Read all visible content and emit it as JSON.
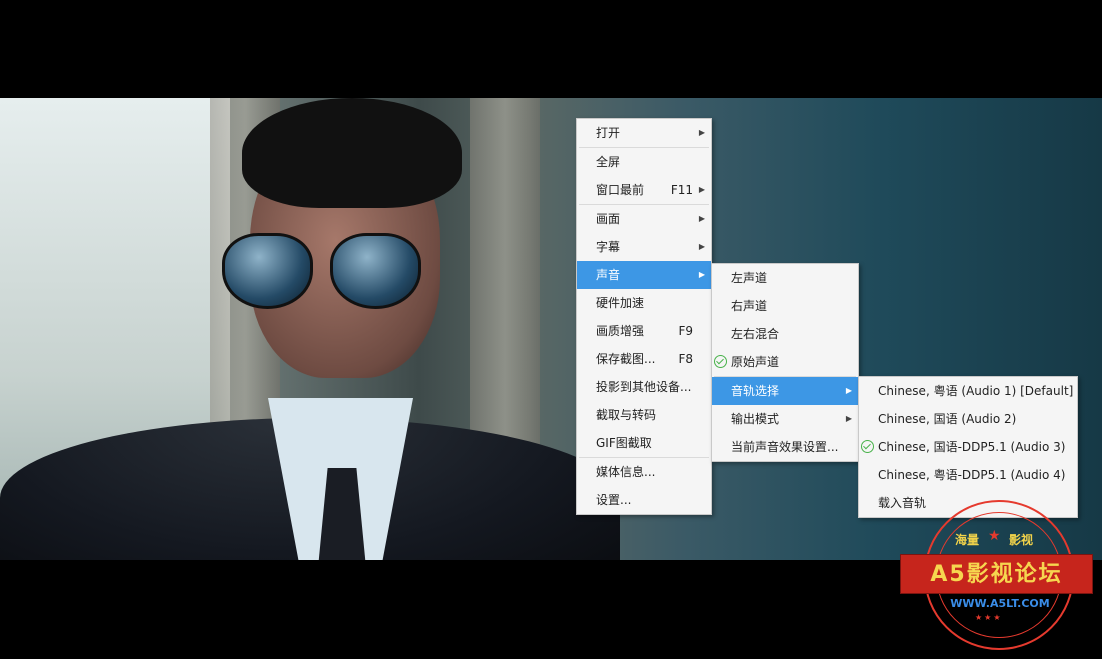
{
  "main_menu": [
    {
      "label": "打开",
      "shortcut": "",
      "submenu": true
    },
    {
      "sep": true
    },
    {
      "label": "全屏",
      "shortcut": "",
      "submenu": false
    },
    {
      "label": "窗口最前",
      "shortcut": "F11",
      "submenu": true
    },
    {
      "sep": true
    },
    {
      "label": "画面",
      "shortcut": "",
      "submenu": true
    },
    {
      "label": "字幕",
      "shortcut": "",
      "submenu": true
    },
    {
      "label": "声音",
      "shortcut": "",
      "submenu": true,
      "highlighted": true
    },
    {
      "label": "硬件加速",
      "shortcut": "",
      "submenu": false
    },
    {
      "label": "画质增强",
      "shortcut": "F9",
      "submenu": false
    },
    {
      "label": "保存截图...",
      "shortcut": "F8",
      "submenu": false
    },
    {
      "label": "投影到其他设备...",
      "shortcut": "",
      "submenu": false
    },
    {
      "label": "截取与转码",
      "shortcut": "",
      "submenu": false
    },
    {
      "label": "GIF图截取",
      "shortcut": "",
      "submenu": false
    },
    {
      "sep": true
    },
    {
      "label": "媒体信息...",
      "shortcut": "",
      "submenu": false
    },
    {
      "label": "设置...",
      "shortcut": "",
      "submenu": false
    }
  ],
  "sound_menu": [
    {
      "label": "左声道"
    },
    {
      "label": "右声道"
    },
    {
      "label": "左右混合"
    },
    {
      "label": "原始声道",
      "checked": true
    },
    {
      "sep": true
    },
    {
      "label": "音轨选择",
      "submenu": true,
      "highlighted": true
    },
    {
      "label": "输出模式",
      "submenu": true
    },
    {
      "label": "当前声音效果设置..."
    }
  ],
  "track_menu": [
    {
      "label": "Chinese, 粤语 (Audio 1) [Default]"
    },
    {
      "label": "Chinese, 国语 (Audio 2)"
    },
    {
      "label": "Chinese, 国语-DDP5.1 (Audio 3)",
      "checked": true
    },
    {
      "label": "Chinese, 粤语-DDP5.1 (Audio 4)"
    },
    {
      "label": "载入音轨"
    }
  ],
  "watermark": {
    "top_left": "海量",
    "top_right": "影视",
    "title": "A5影视论坛",
    "url": "WWW.A5LT.COM",
    "stars": "★★★",
    "accent_color": "#c6251c",
    "text_color": "#f6d64f"
  },
  "colors": {
    "highlight": "#3d97e5",
    "check": "#48b24a"
  }
}
